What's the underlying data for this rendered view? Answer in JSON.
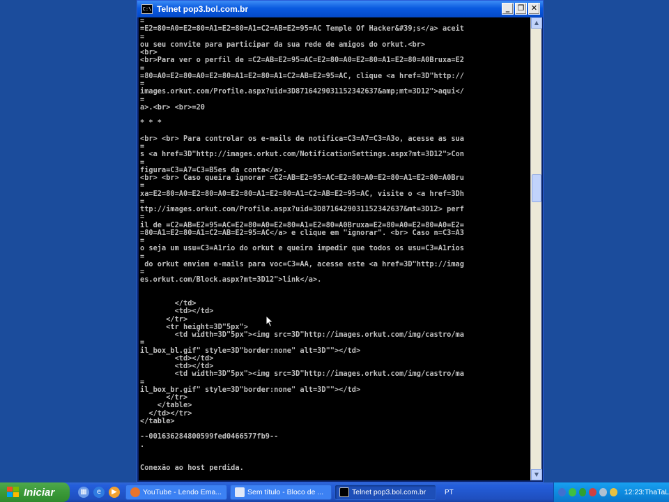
{
  "window": {
    "title": "Telnet pop3.bol.com.br",
    "icon_label": "C:\\",
    "minimize_label": "_",
    "maximize_label": "❐",
    "close_label": "✕"
  },
  "console": {
    "text": "=\n=E2=80=A0=E2=80=A1=E2=80=A1=C2=AB=E2=95=AC Temple Of Hacker&#39;s</a> aceit\n=\nou seu convite para participar da sua rede de amigos do orkut.<br>\n<br>\n<br>Para ver o perfil de =C2=AB=E2=95=AC=E2=80=A0=E2=80=A1=E2=80=A0Bruxa=E2\n=\n=80=A0=E2=80=A0=E2=80=A1=E2=80=A1=C2=AB=E2=95=AC, clique <a href=3D\"http://\n=\nimages.orkut.com/Profile.aspx?uid=3D8716429031152342637&amp;mt=3D12\">aqui</\n=\na>.<br> <br>=20\n\n* * *\n\n<br> <br> Para controlar os e-mails de notifica=C3=A7=C3=A3o, acesse as sua\n=\ns <a href=3D\"http://images.orkut.com/NotificationSettings.aspx?mt=3D12\">Con\n=\nfigura=C3=A7=C3=B5es da conta</a>.\n<br> <br> Caso queira ignorar =C2=AB=E2=95=AC=E2=80=A0=E2=80=A1=E2=80=A0Bru\n=\nxa=E2=80=A0=E2=80=A0=E2=80=A1=E2=80=A1=C2=AB=E2=95=AC, visite o <a href=3Dh\n=\nttp://images.orkut.com/Profile.aspx?uid=3D8716429031152342637&mt=3D12> perf\n=\nil de =C2=AB=E2=95=AC=E2=80=A0=E2=80=A1=E2=80=A0Bruxa=E2=80=A0=E2=80=A0=E2=\n=80=A1=E2=80=A1=C2=AB=E2=95=AC</a> e clique em \"ignorar\". <br> Caso n=C3=A3\n=\no seja um usu=C3=A1rio do orkut e queira impedir que todos os usu=C3=A1rios\n=\n do orkut enviem e-mails para voc=C3=AA, acesse este <a href=3D\"http://imag\n=\nes.orkut.com/Block.aspx?mt=3D12\">link</a>.\n\n\n        </td>\n        <td></td>\n      </tr>\n      <tr height=3D\"5px\">\n        <td width=3D\"5px\"><img src=3D\"http://images.orkut.com/img/castro/ma\n=\nil_box_bl.gif\" style=3D\"border:none\" alt=3D\"\"></td>\n        <td></td>\n        <td></td>\n        <td width=3D\"5px\"><img src=3D\"http://images.orkut.com/img/castro/ma\n=\nil_box_br.gif\" style=3D\"border:none\" alt=3D\"\"></td>\n      </tr>\n    </table>\n  </td></tr>\n</table>\n\n--001636284800599fed0466577fb9--\n.\n\n\nConexão ao host perdida."
  },
  "taskbar": {
    "start_label": "Iniciar",
    "tasks": [
      {
        "label": "YouTube - Lendo Ema...",
        "icon_color": "#e8742a"
      },
      {
        "label": "Sem título - Bloco de ...",
        "icon_color": "#e0e8f8"
      },
      {
        "label": "Telnet pop3.bol.com.br",
        "icon_color": "#000000"
      }
    ],
    "language": "PT",
    "clock": "12:23:ThaTaL"
  },
  "colors": {
    "desktop": "#1b4c9c",
    "console_bg": "#000000",
    "console_fg": "#c0c0c0",
    "title_bar": "#0a5ae0"
  }
}
